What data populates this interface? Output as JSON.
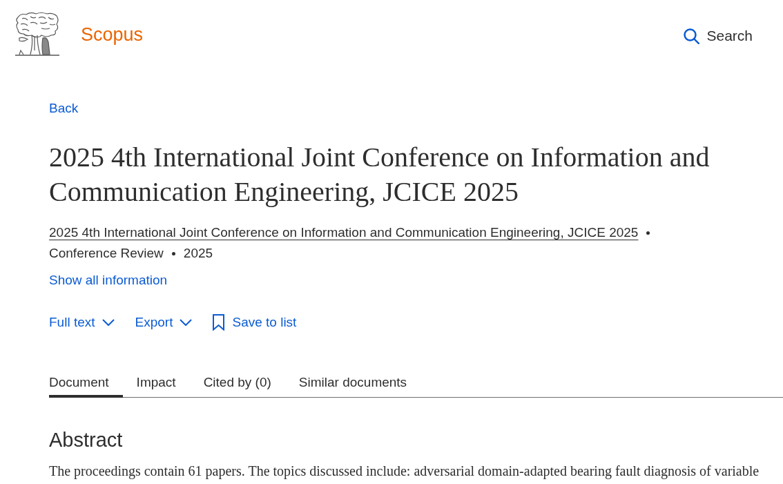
{
  "header": {
    "brand": "Scopus",
    "search_label": "Search"
  },
  "back_link": "Back",
  "title": "2025 4th International Joint Conference on Information and Communication Engineering, JCICE 2025",
  "meta": [
    {
      "kind": "link",
      "text": "2025 4th International Joint Conference on Information and Communication Engineering, JCICE 2025"
    },
    {
      "kind": "text",
      "text": "Conference Review"
    },
    {
      "kind": "text",
      "text": "2025"
    }
  ],
  "show_all_link": "Show all information",
  "actions": [
    {
      "kind": "dropdown",
      "label": "Full text"
    },
    {
      "kind": "dropdown",
      "label": "Export"
    },
    {
      "kind": "bookmark",
      "label": "Save to list"
    }
  ],
  "tabs": [
    {
      "label": "Document",
      "selected": true
    },
    {
      "label": "Impact",
      "selected": false
    },
    {
      "label": "Cited by (0)",
      "selected": false
    },
    {
      "label": "Similar documents",
      "selected": false
    }
  ],
  "abstract": {
    "heading": "Abstract",
    "text": "The proceedings contain 61 papers. The topics discussed include: adversarial domain-adapted bearing fault diagnosis of variable"
  }
}
